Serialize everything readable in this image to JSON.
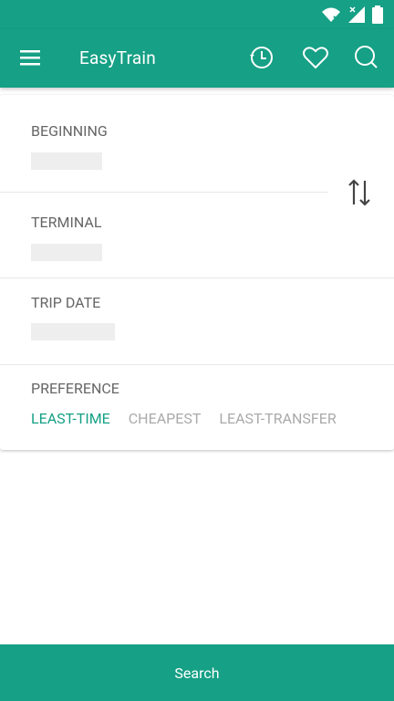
{
  "app": {
    "title": "EasyTrain",
    "accent": "#16a085"
  },
  "statusbar": {
    "icons": [
      "wifi-icon",
      "signal-icon",
      "battery-icon"
    ]
  },
  "appbar": {
    "menu_icon": "menu-icon",
    "actions": [
      "history-icon",
      "heart-icon",
      "search-icon"
    ]
  },
  "form": {
    "beginning_label": "BEGINNING",
    "terminal_label": "TERMINAL",
    "trip_date_label": "TRIP DATE",
    "preference_label": "PREFERENCE",
    "preferences": [
      {
        "label": "LEAST-TIME",
        "active": true
      },
      {
        "label": "CHEAPEST",
        "active": false
      },
      {
        "label": "LEAST-TRANSFER",
        "active": false
      }
    ]
  },
  "bottom": {
    "search_label": "Search"
  }
}
